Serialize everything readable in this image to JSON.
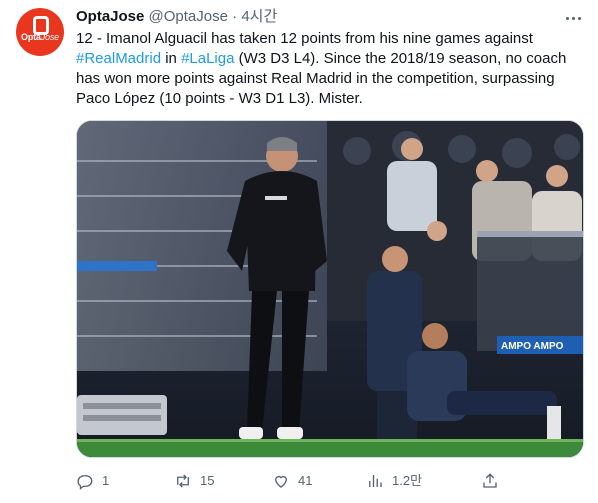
{
  "author": {
    "display_name": "OptaJose",
    "handle": "@OptaJose",
    "separator": "·",
    "time": "4시간",
    "avatar_text_bold": "Opta",
    "avatar_text_italic": "Jose"
  },
  "tweet": {
    "text_1": "12 - Imanol Alguacil has taken 12 points from his nine games against ",
    "hashtag_1": "#RealMadrid",
    "text_2": " in ",
    "hashtag_2": "#LaLiga",
    "text_3": " (W3 D3 L4). Since the 2018/19 season, no coach has won more points against Real Madrid in the competition, surpassing Paco López (10 points - W3 D1 L3). Mister."
  },
  "media": {
    "board_text": "AMPO  AMPO"
  },
  "actions": {
    "reply_count": "1",
    "retweet_count": "15",
    "like_count": "41",
    "views_count": "1.2만"
  },
  "colors": {
    "link": "#1d9bf0",
    "secondary_text": "#536471",
    "avatar_bg": "#e8361f"
  },
  "icons": {
    "more": "more-horizontal-icon",
    "reply": "reply-icon",
    "retweet": "retweet-icon",
    "like": "heart-icon",
    "views": "bar-chart-icon",
    "share": "share-icon"
  }
}
